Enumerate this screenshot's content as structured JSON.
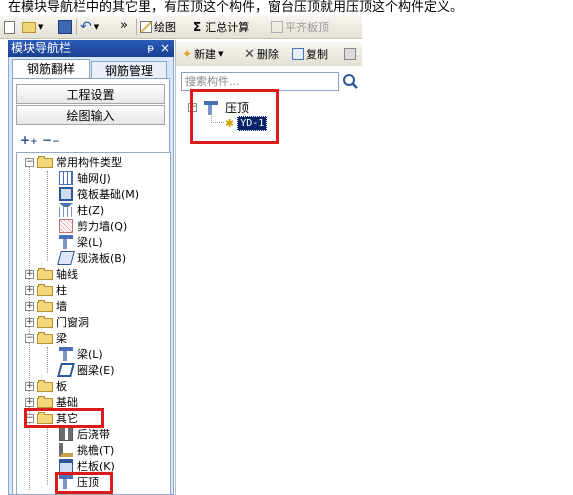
{
  "caption": "在模块导航栏中的其它里，有压顶这个构件，窗台压顶就用压顶这个构件定义。",
  "toolbar": {
    "more": "»",
    "draw": "绘图",
    "sum_icon": "Σ",
    "sum": "汇总计算",
    "align": "平齐板顶"
  },
  "nav": {
    "title": "模块导航栏",
    "pin": "ᵽ",
    "close": "×",
    "tabs": [
      "钢筋翻样",
      "钢筋管理"
    ],
    "project_settings": "工程设置",
    "draw_input": "绘图输入",
    "tree": {
      "common": "常用构件类型",
      "common_items": [
        "轴网(J)",
        "筏板基础(M)",
        "柱(Z)",
        "剪力墙(Q)",
        "梁(L)",
        "现浇板(B)"
      ],
      "axis": "轴线",
      "column": "柱",
      "wall": "墙",
      "door_window": "门窗洞",
      "beam": "梁",
      "beam_items": [
        "梁(L)",
        "圈梁(E)"
      ],
      "slab": "板",
      "foundation": "基础",
      "other": "其它",
      "other_items": [
        "后浇带",
        "挑檐(T)",
        "栏板(K)",
        "压顶"
      ]
    }
  },
  "component": {
    "new": "新建",
    "delete": "删除",
    "copy": "复制",
    "search_placeholder": "搜索构件...",
    "group": "压顶",
    "item": "YD-1"
  },
  "colors": {
    "highlight": "#d91b1b",
    "header_blue": "#1f4da6",
    "selected_bg": "#0a246a"
  }
}
